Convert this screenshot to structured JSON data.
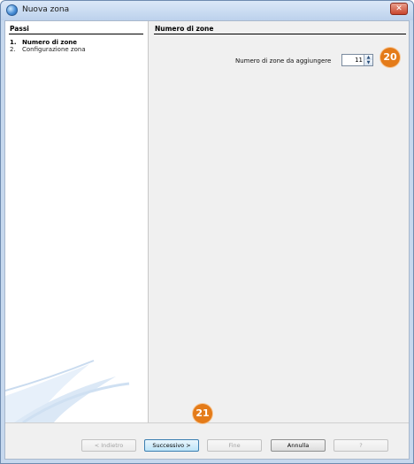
{
  "window": {
    "title": "Nuova zona",
    "close_glyph": "✕"
  },
  "steps_panel": {
    "header": "Passi",
    "steps": [
      {
        "number": "1.",
        "label": "Numero di zone",
        "active": true
      },
      {
        "number": "2.",
        "label": "Configurazione zona",
        "active": false
      }
    ]
  },
  "main": {
    "header": "Numero di zone",
    "field_label": "Numero di zone da aggiungere",
    "zone_count": "11"
  },
  "annotations": {
    "badge_spinner": "20",
    "badge_next": "21",
    "badge_color": "#e47b19"
  },
  "buttons": {
    "back": "< Indietro",
    "next": "Successivo >",
    "finish": "Fine",
    "cancel": "Annulla",
    "help": "?"
  },
  "icons": {
    "app": "app-globe-icon",
    "close": "close-icon",
    "spin_up": "spin-up-arrow-icon",
    "spin_down": "spin-down-arrow-icon"
  }
}
